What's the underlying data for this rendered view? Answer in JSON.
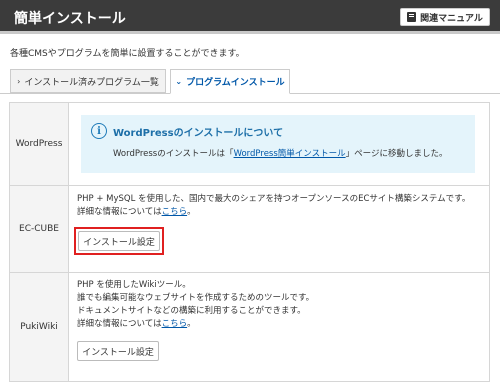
{
  "header": {
    "title": "簡単インストール",
    "manual_label": "関連マニュアル"
  },
  "intro": "各種CMSやプログラムを簡単に設置することができます。",
  "tabs": [
    {
      "label": "インストール済みプログラム一覧",
      "active": false
    },
    {
      "label": "プログラムインストール",
      "active": true
    }
  ],
  "rows": {
    "wordpress": {
      "label": "WordPress",
      "info_title": "WordPressのインストールについて",
      "info_text_before": "WordPressのインストールは「",
      "info_link": "WordPress簡単インストール",
      "info_text_after": "」ページに移動しました。"
    },
    "eccube": {
      "label": "EC-CUBE",
      "desc_line1": "PHP + MySQL を使用した、国内で最大のシェアを持つオープンソースのECサイト構築システムです。",
      "desc_line2_before": "詳細な情報については",
      "desc_link": "こちら",
      "desc_line2_after": "。",
      "button": "インストール設定"
    },
    "pukiwiki": {
      "label": "PukiWiki",
      "desc_line1": "PHP を使用したWikiツール。",
      "desc_line2": "誰でも編集可能なウェブサイトを作成するためのツールです。",
      "desc_line3": "ドキュメントサイトなどの構築に利用することができます。",
      "desc_line4_before": "詳細な情報については",
      "desc_link": "こちら",
      "desc_line4_after": "。",
      "button": "インストール設定"
    }
  },
  "colors": {
    "header_bg": "#3b3b3b",
    "link": "#0057a8",
    "info_bg": "#e4f4fb",
    "highlight": "#e02020"
  }
}
